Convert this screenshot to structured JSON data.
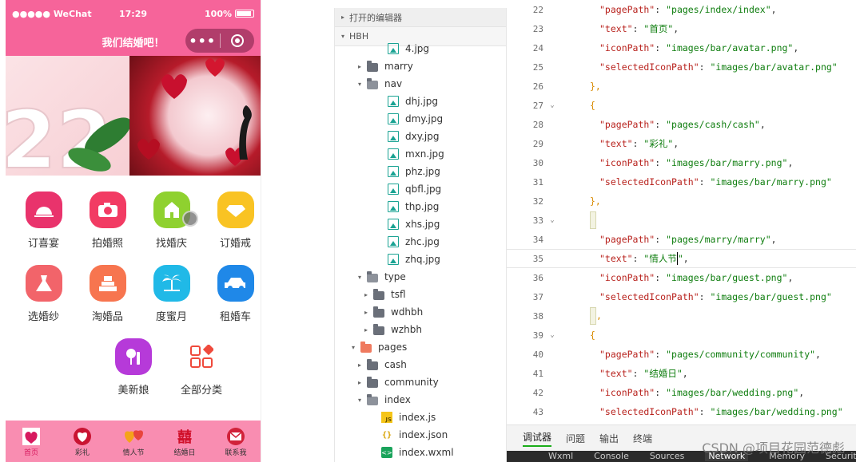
{
  "phone": {
    "status": {
      "carrier": "●●●●● WeChat",
      "time": "17:29",
      "battery": "100%"
    },
    "nav_title": "我们结婚吧！",
    "grid": [
      {
        "label": "订喜宴",
        "icon": "banquet-icon",
        "color": "#e9336c"
      },
      {
        "label": "拍婚照",
        "icon": "camera-icon",
        "color": "#f23b63"
      },
      {
        "label": "找婚庆",
        "icon": "chapel-icon",
        "color": "#8fd12f"
      },
      {
        "label": "订婚戒",
        "icon": "ring-icon",
        "color": "#f9c323"
      },
      {
        "label": "选婚纱",
        "icon": "dress-icon",
        "color": "#f2646a"
      },
      {
        "label": "淘婚品",
        "icon": "cake-icon",
        "color": "#f7754f"
      },
      {
        "label": "度蜜月",
        "icon": "palm-icon",
        "color": "#20b9e7"
      },
      {
        "label": "租婚车",
        "icon": "car-icon",
        "color": "#1f88e8"
      },
      {
        "label": "美新娘",
        "icon": "makeup-icon",
        "color": "#b63ad9"
      },
      {
        "label": "全部分类",
        "icon": "categories-icon",
        "color": "#ffffff"
      }
    ],
    "tabs": [
      {
        "label": "首页",
        "icon": "couple-icon"
      },
      {
        "label": "彩礼",
        "icon": "gift-heart-icon"
      },
      {
        "label": "情人节",
        "icon": "hearts-icon"
      },
      {
        "label": "结婚日",
        "icon": "double-happiness-icon"
      },
      {
        "label": "联系我",
        "icon": "mail-icon"
      }
    ]
  },
  "tree": {
    "header_editors": "打开的编辑器",
    "header_project": "HBH",
    "rows": [
      {
        "label": "4.jpg",
        "type": "img",
        "indent": 52,
        "twisty": ""
      },
      {
        "label": "marry",
        "type": "folder",
        "indent": 26,
        "twisty": "▸"
      },
      {
        "label": "nav",
        "type": "folder-open",
        "indent": 26,
        "twisty": "▾"
      },
      {
        "label": "dhj.jpg",
        "type": "img",
        "indent": 52,
        "twisty": ""
      },
      {
        "label": "dmy.jpg",
        "type": "img",
        "indent": 52,
        "twisty": ""
      },
      {
        "label": "dxy.jpg",
        "type": "img",
        "indent": 52,
        "twisty": ""
      },
      {
        "label": "mxn.jpg",
        "type": "img",
        "indent": 52,
        "twisty": ""
      },
      {
        "label": "phz.jpg",
        "type": "img",
        "indent": 52,
        "twisty": ""
      },
      {
        "label": "qbfl.jpg",
        "type": "img",
        "indent": 52,
        "twisty": ""
      },
      {
        "label": "thp.jpg",
        "type": "img",
        "indent": 52,
        "twisty": ""
      },
      {
        "label": "xhs.jpg",
        "type": "img",
        "indent": 52,
        "twisty": ""
      },
      {
        "label": "zhc.jpg",
        "type": "img",
        "indent": 52,
        "twisty": ""
      },
      {
        "label": "zhq.jpg",
        "type": "img",
        "indent": 52,
        "twisty": ""
      },
      {
        "label": "type",
        "type": "folder-open",
        "indent": 26,
        "twisty": "▾"
      },
      {
        "label": "tsfl",
        "type": "folder",
        "indent": 34,
        "twisty": "▸"
      },
      {
        "label": "wdhbh",
        "type": "folder",
        "indent": 34,
        "twisty": "▸"
      },
      {
        "label": "wzhbh",
        "type": "folder",
        "indent": 34,
        "twisty": "▸"
      },
      {
        "label": "pages",
        "type": "folder-pages",
        "indent": 18,
        "twisty": "▾"
      },
      {
        "label": "cash",
        "type": "folder",
        "indent": 26,
        "twisty": "▸"
      },
      {
        "label": "community",
        "type": "folder",
        "indent": 26,
        "twisty": "▸"
      },
      {
        "label": "index",
        "type": "folder-open",
        "indent": 26,
        "twisty": "▾"
      },
      {
        "label": "index.js",
        "type": "js",
        "indent": 44,
        "twisty": ""
      },
      {
        "label": "index.json",
        "type": "json",
        "indent": 44,
        "twisty": ""
      },
      {
        "label": "index.wxml",
        "type": "wxml",
        "indent": 44,
        "twisty": ""
      }
    ]
  },
  "editor": {
    "lines": [
      {
        "n": "22",
        "fold": "",
        "html": "\"pagePath\": \"pages/index/index\","
      },
      {
        "n": "23",
        "fold": "",
        "html": "\"text\": \"首页\","
      },
      {
        "n": "24",
        "fold": "",
        "html": "\"iconPath\": \"images/bar/avatar.png\","
      },
      {
        "n": "25",
        "fold": "",
        "html": "\"selectedIconPath\": \"images/bar/avatar.png\""
      },
      {
        "n": "26",
        "fold": "",
        "html": "},"
      },
      {
        "n": "27",
        "fold": "⌄",
        "html": "{"
      },
      {
        "n": "28",
        "fold": "",
        "html": "\"pagePath\": \"pages/cash/cash\","
      },
      {
        "n": "29",
        "fold": "",
        "html": "\"text\": \"彩礼\","
      },
      {
        "n": "30",
        "fold": "",
        "html": "\"iconPath\": \"images/bar/marry.png\","
      },
      {
        "n": "31",
        "fold": "",
        "html": "\"selectedIconPath\": \"images/bar/marry.png\""
      },
      {
        "n": "32",
        "fold": "",
        "html": "},"
      },
      {
        "n": "33",
        "fold": "⌄",
        "html": "{"
      },
      {
        "n": "34",
        "fold": "",
        "html": "\"pagePath\": \"pages/marry/marry\","
      },
      {
        "n": "35",
        "fold": "",
        "html": "\"text\": \"情人节\","
      },
      {
        "n": "36",
        "fold": "",
        "html": "\"iconPath\": \"images/bar/guest.png\","
      },
      {
        "n": "37",
        "fold": "",
        "html": "\"selectedIconPath\": \"images/bar/guest.png\""
      },
      {
        "n": "38",
        "fold": "",
        "html": "},"
      },
      {
        "n": "39",
        "fold": "⌄",
        "html": "{"
      },
      {
        "n": "40",
        "fold": "",
        "html": "\"pagePath\": \"pages/community/community\","
      },
      {
        "n": "41",
        "fold": "",
        "html": "\"text\": \"结婚日\","
      },
      {
        "n": "42",
        "fold": "",
        "html": "\"iconPath\": \"images/bar/wedding.png\","
      },
      {
        "n": "43",
        "fold": "",
        "html": "\"selectedIconPath\": \"images/bar/wedding.png\""
      }
    ]
  },
  "panel_tabs": [
    "调试器",
    "问题",
    "输出",
    "终端"
  ],
  "devtools_tabs": [
    "Wxml",
    "Console",
    "Sources",
    "Network",
    "Memory",
    "Security"
  ],
  "watermark": "CSDN @项目花园范德彪"
}
